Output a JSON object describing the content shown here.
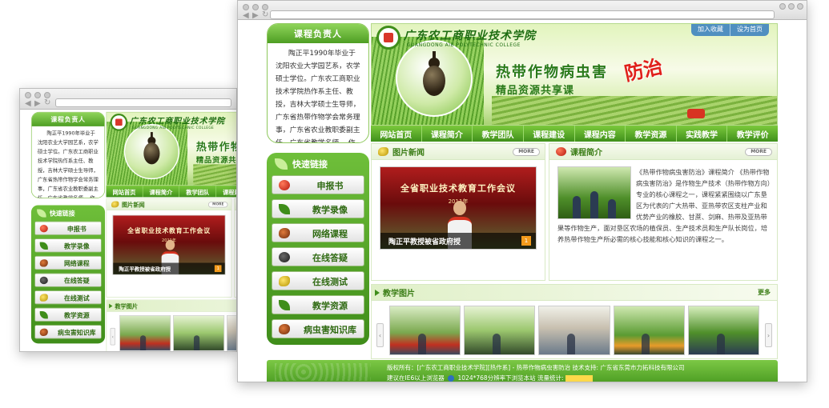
{
  "page": {
    "teacher": {
      "heading": "课程负责人",
      "bio": "陶正平1990年毕业于沈阳农业大学园艺系，农学硕士学位。广东农工商职业技术学院热作系主任、教授，吉林大学硕士生导师，广东省热带作物学会常务理事，广东省农业教职委副主任，广东省教学名师。 作物"
    },
    "quick_links": {
      "heading": "快速链接",
      "items": [
        {
          "label": "申报书",
          "icon": "apple-icon"
        },
        {
          "label": "教学录像",
          "icon": "leaf-icon"
        },
        {
          "label": "网络课程",
          "icon": "insect-icon"
        },
        {
          "label": "在线答疑",
          "icon": "beetle-icon"
        },
        {
          "label": "在线测试",
          "icon": "wasp-icon"
        },
        {
          "label": "教学资源",
          "icon": "leaf-icon"
        },
        {
          "label": "病虫害知识库",
          "icon": "bug-icon"
        }
      ]
    },
    "header": {
      "college_cn": "广东农工商职业技术学院",
      "college_en": "GUANGDONG AIB POLYTECHNIC COLLEGE",
      "title_main": "热带作物病虫害",
      "title_accent": "防治",
      "subtitle": "精品资源共享课",
      "links": [
        "加入收藏",
        "设为首页"
      ]
    },
    "nav": [
      "网站首页",
      "课程简介",
      "教学团队",
      "课程建设",
      "课程内容",
      "教学资源",
      "实践教学",
      "教学评价"
    ],
    "news": {
      "heading": "图片新闻",
      "more": "MORE",
      "banner": "全省职业技术教育工作会议",
      "banner_sub": "2011年",
      "caption": "陶正平教授被省政府授",
      "page_num": "1"
    },
    "intro": {
      "heading": "课程简介",
      "more": "MORE",
      "text": "《热带作物病虫害防治》课程简介 《热带作物病虫害防治》是作物生产技术（热带作物方向）专业的核心课程之一，课程紧紧围绕以广东垦区为代表的广大热带、亚热带农区支柱产业和优势产业的橡胶、甘蔗、剑麻、热带及亚热带果等作物生产，面对垦区农场的植保员、生产技术员和生产队长岗位，培养热带作物生产所必需的核心技能和核心知识的课程之一。"
    },
    "teaching_photos": {
      "heading": "教学图片",
      "more": "更多",
      "prev": "‹",
      "next": "›"
    },
    "footer": {
      "line1": "版权所有：[广东农工商职业技术学院][热作系] - 热带作物病虫害防治  技术支持: 广东省东莞市力拓科技有限公司",
      "line2_a": "建议在IE6以上浏览器",
      "line2_b": "1024*768分辨率下浏览本站  流量统计:"
    }
  },
  "front_browser_page_scale": 1.0
}
